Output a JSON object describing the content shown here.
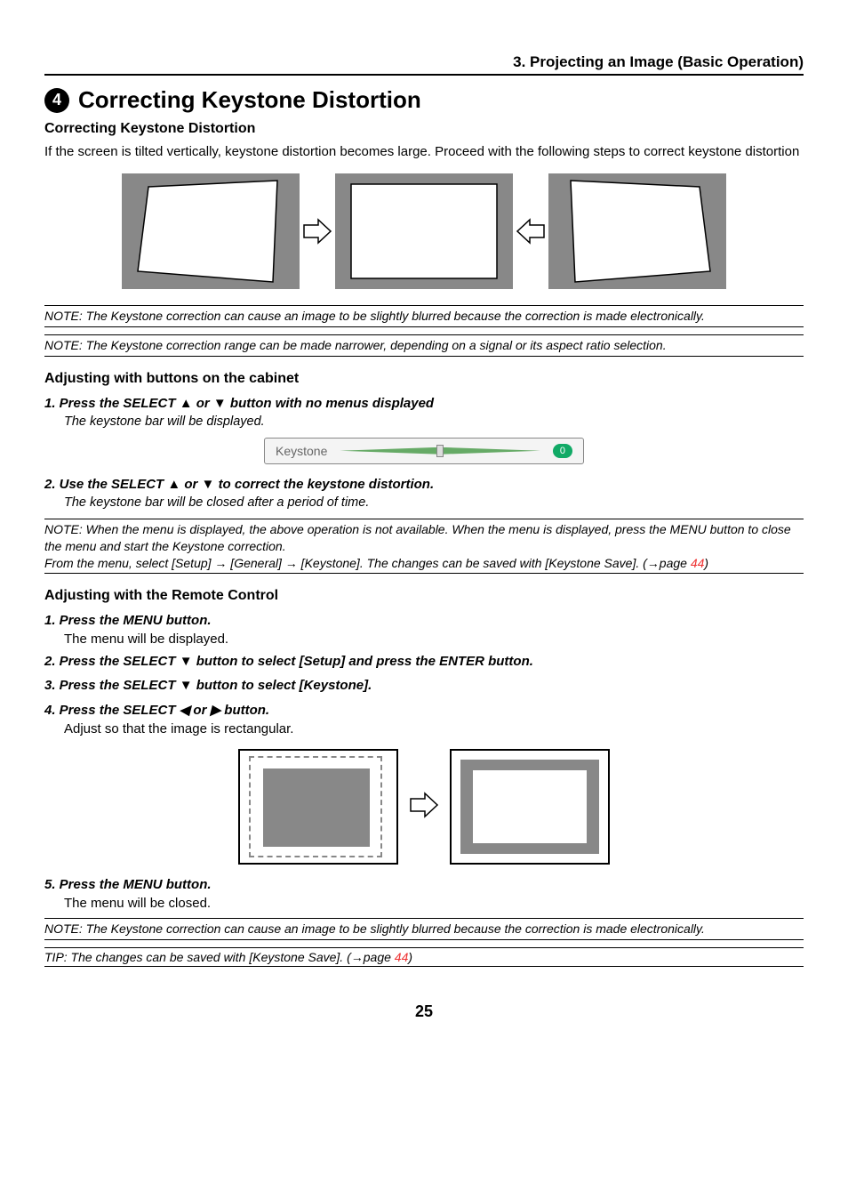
{
  "chapter": "3. Projecting an Image (Basic Operation)",
  "sectionNumber": "4",
  "sectionTitle": "Correcting Keystone Distortion",
  "sub1": "Correcting Keystone Distortion",
  "intro": "If the screen is tilted vertically, keystone distortion becomes large. Proceed with the following steps to correct keystone distortion",
  "note1": "NOTE: The Keystone correction can cause an image to be slightly blurred because the correction is made electronically.",
  "note2": "NOTE: The Keystone correction range can be made narrower, depending on a signal or its aspect ratio selection.",
  "sub2": "Adjusting with buttons on the cabinet",
  "step1": "1.  Press the SELECT ▲ or ▼ button with no menus displayed",
  "step1note": "The keystone bar will be displayed.",
  "keystoneLabel": "Keystone",
  "keystoneValue": "0",
  "step2": "2.  Use the SELECT ▲ or ▼ to correct the keystone distortion.",
  "step2note": "The keystone bar will be closed after a period of time.",
  "note3a": "NOTE: When the menu is displayed, the above operation is not available. When the menu is displayed, press the MENU button to close the menu and start the Keystone correction.",
  "note3b_prefix": "From the menu, select [Setup] → [General] → [Keystone]. The changes can be saved with [Keystone Save]. (→page ",
  "note3b_link": "44",
  "note3b_suffix": ")",
  "sub3": "Adjusting with the Remote Control",
  "rc1": "1.  Press the MENU button.",
  "rc1note": "The menu will be displayed.",
  "rc2": "2.  Press the SELECT ▼ button to select [Setup] and press the ENTER button.",
  "rc3": "3.  Press the SELECT ▼ button to select [Keystone].",
  "rc4": "4.  Press the SELECT ◀ or ▶ button.",
  "rc4note": "Adjust so that the image is rectangular.",
  "rc5": "5.  Press the MENU button.",
  "rc5note": "The menu will be closed.",
  "note4": "NOTE: The Keystone correction can cause an image to be slightly blurred because the correction is made electronically.",
  "tip_prefix": "TIP: The changes can be saved with [Keystone Save]. (→page ",
  "tip_link": "44",
  "tip_suffix": ")",
  "pageNum": "25"
}
